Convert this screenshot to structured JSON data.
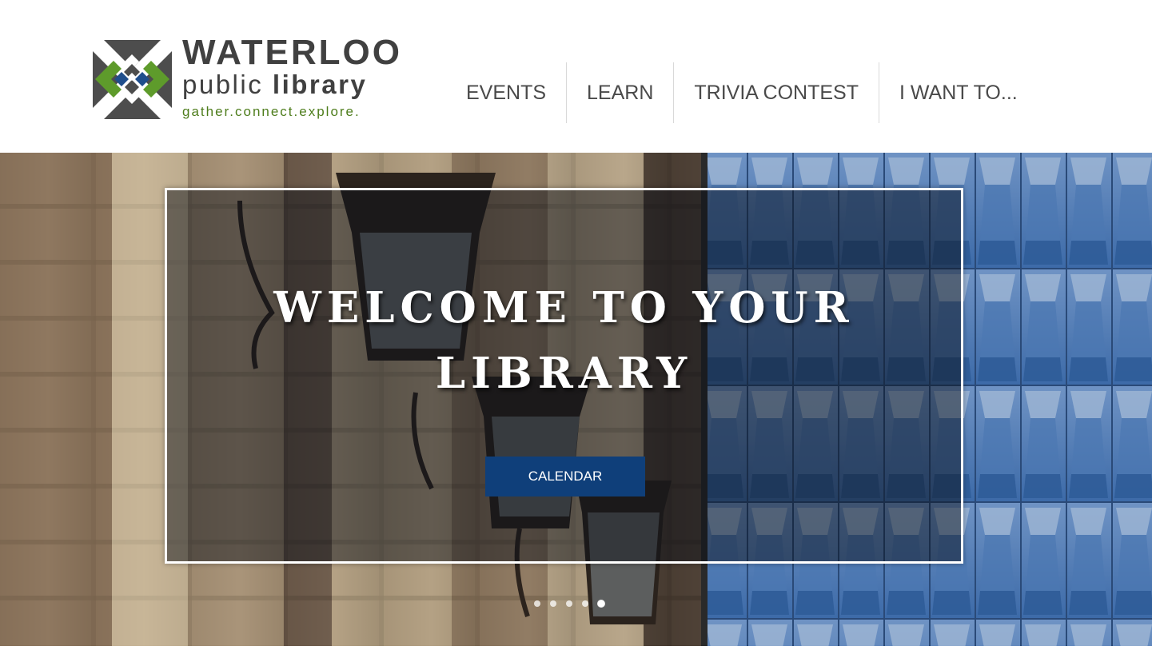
{
  "header": {
    "logo": {
      "title": "WATERLOO",
      "subtitle_light": "public",
      "subtitle_bold": "library",
      "tagline": "gather.connect.explore."
    },
    "nav": [
      {
        "label": "EVENTS"
      },
      {
        "label": "LEARN"
      },
      {
        "label": "TRIVIA CONTEST"
      },
      {
        "label": "I WANT TO..."
      }
    ]
  },
  "hero": {
    "title": "WELCOME TO YOUR LIBRARY",
    "button_label": "CALENDAR",
    "slide_count": 5,
    "active_slide": 5
  },
  "colors": {
    "logo_green": "#5e9b2b",
    "logo_blue": "#1f4e8c",
    "logo_gray": "#4d4d4d",
    "tagline_green": "#4e7d1c",
    "button_blue": "#0f3f7a"
  },
  "icons": [
    "library-logo-icon"
  ]
}
